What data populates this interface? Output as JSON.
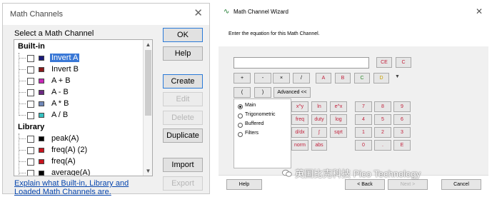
{
  "math_channels": {
    "title": "Math Channels",
    "select_label": "Select a Math Channel",
    "groups": {
      "builtin": {
        "label": "Built-in",
        "items": [
          {
            "label": "Invert A",
            "color": "#1a1a7a",
            "selected": true
          },
          {
            "label": "Invert B",
            "color": "#8a1a1a"
          },
          {
            "label": "A + B",
            "color": "#c828b8"
          },
          {
            "label": "A - B",
            "color": "#6b2a82"
          },
          {
            "label": "A * B",
            "color": "#7088b8"
          },
          {
            "label": "A / B",
            "color": "#36c2c2"
          }
        ]
      },
      "library": {
        "label": "Library",
        "items": [
          {
            "label": "peak(A)",
            "color": "#000000"
          },
          {
            "label": "freq(A) (2)",
            "color": "#c8141e"
          },
          {
            "label": "freq(A)",
            "color": "#c8141e"
          },
          {
            "label": "average(A)",
            "color": "#000000"
          }
        ]
      }
    },
    "link": "Explain what Built-in, Library and Loaded Math Channels are.",
    "buttons": {
      "ok": "OK",
      "help": "Help",
      "create": "Create",
      "edit": "Edit",
      "delete": "Delete",
      "duplicate": "Duplicate",
      "import": "Import",
      "export": "Export"
    }
  },
  "wizard": {
    "title": "Math Channel Wizard",
    "instruction": "Enter the equation for this Math Channel.",
    "equation": "",
    "clear_keys": {
      "ce": "CE",
      "c": "C"
    },
    "operators": [
      "+",
      "-",
      "×",
      "/"
    ],
    "channels": [
      {
        "label": "A",
        "color": "#c21f3a"
      },
      {
        "label": "B",
        "color": "#c21f3a"
      },
      {
        "label": "C",
        "color": "#2e8b2e"
      },
      {
        "label": "D",
        "color": "#c8a000"
      }
    ],
    "parens": [
      "(",
      ")"
    ],
    "advanced": "Advanced <<",
    "categories": [
      {
        "label": "Main",
        "checked": true
      },
      {
        "label": "Trigonometric",
        "checked": false
      },
      {
        "label": "Buffered",
        "checked": false
      },
      {
        "label": "Filters",
        "checked": false
      }
    ],
    "functions": [
      "x^y",
      "ln",
      "e^x",
      "freq",
      "duty",
      "log",
      "d/dx",
      "∫",
      "sqrt",
      "norm",
      "abs"
    ],
    "numpad": [
      "7",
      "8",
      "9",
      "4",
      "5",
      "6",
      "1",
      "2",
      "3",
      "0",
      ".",
      "E"
    ],
    "footer": {
      "help": "Help",
      "back": "< Back",
      "next": "Next >",
      "cancel": "Cancel"
    },
    "watermark": "英国比克科技 Pico Technology"
  },
  "colors": {
    "selection": "#3a78d6",
    "link": "#0645ad",
    "accent_red": "#c21f3a"
  }
}
